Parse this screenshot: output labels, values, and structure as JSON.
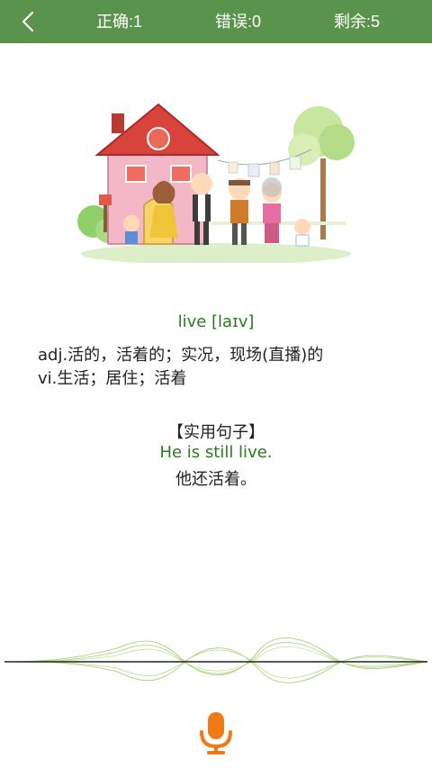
{
  "header": {
    "correct_label": "正确:1",
    "wrong_label": "错误:0",
    "remaining_label": "剩余:5"
  },
  "word": {
    "headword": "live [laɪv]",
    "definitions": [
      "adj.活的，活着的；实况，现场(直播)的",
      "vi.生活；居住；活着"
    ]
  },
  "example": {
    "section_title": "【实用句子】",
    "sentence_en": "He is still live.",
    "sentence_zh": "他还活着。"
  },
  "colors": {
    "header_bg": "#5a944c",
    "accent_green": "#2a7a1e",
    "mic_orange": "#f07a16"
  },
  "icons": {
    "back": "chevron-left-icon",
    "mic": "microphone-icon"
  }
}
